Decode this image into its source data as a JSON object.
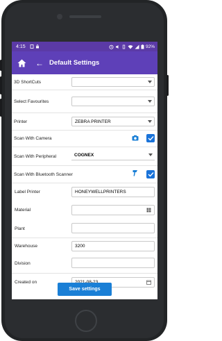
{
  "statusbar": {
    "time": "4:15",
    "battery": "92%"
  },
  "appbar": {
    "title": "Default Settings"
  },
  "form": {
    "shortcuts_label": "3D ShortCuts",
    "favourites_label": "Select Favourites",
    "printer_label": "Printer",
    "printer_value": "ZEBRA PRINTER",
    "scan_camera_label": "Scan With Camera",
    "scan_peripheral_label": "Scan With Peripheral",
    "peripheral_value": "COGNEX",
    "scan_bt_label": "Scan With Bluetooth Scanner",
    "label_printer_label": "Label Printer",
    "label_printer_value": "HONEYWELLPRINTERS",
    "material_label": "Material",
    "plant_label": "Plant",
    "warehouse_label": "Warehouse",
    "warehouse_value": "3200",
    "division_label": "Division",
    "created_on_label": "Created on",
    "created_on_value": "2021-08-23"
  },
  "actions": {
    "save_label": "Save settings"
  },
  "colors": {
    "appbar": "#5e40b8",
    "accent": "#1a7fd6"
  }
}
